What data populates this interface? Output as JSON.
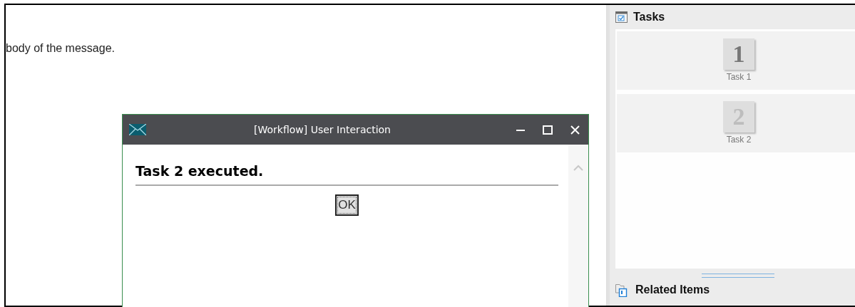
{
  "message": {
    "body": "body of the message."
  },
  "dialog": {
    "title": "[Workflow] User Interaction",
    "heading": "Task 2 executed.",
    "button": "OK"
  },
  "tasks_panel": {
    "title": "Tasks",
    "tasks": [
      {
        "number": "1",
        "label": "Task 1",
        "disabled": false
      },
      {
        "number": "2",
        "label": "Task 2",
        "disabled": true
      }
    ]
  },
  "related_panel": {
    "title": "Related Items"
  }
}
